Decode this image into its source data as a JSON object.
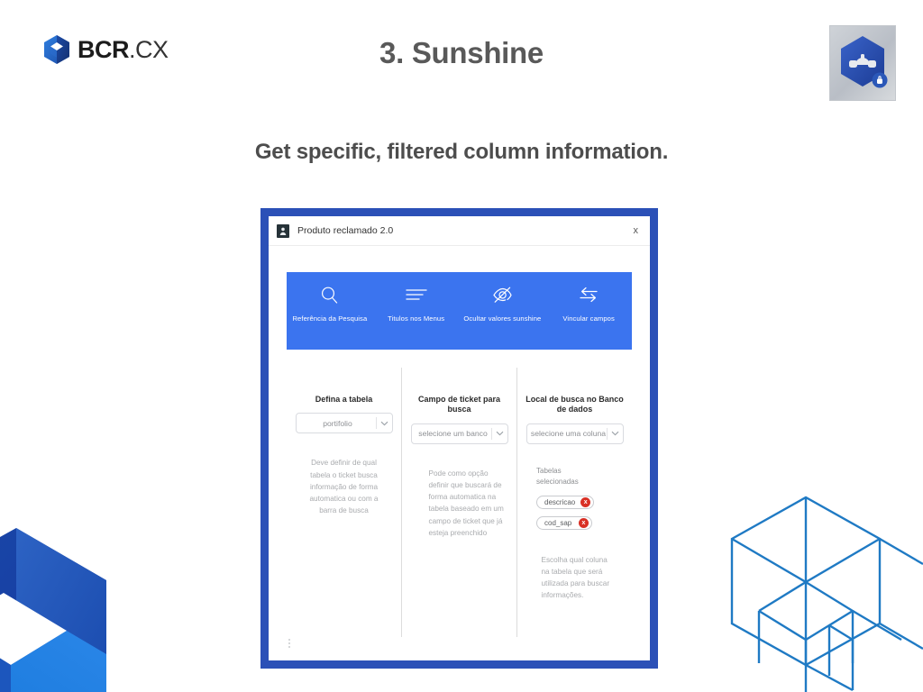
{
  "slide": {
    "title": "3. Sunshine",
    "subtitle": "Get specific, filtered column information.",
    "brand": {
      "name_bold": "BCR",
      "name_thin": ".CX",
      "mark_icon": "bcr-cube-logo-icon"
    },
    "app_badge_icon": "sunshine-hexagon-app-icon"
  },
  "window": {
    "title": "Produto reclamado 2.0",
    "app_icon": "app-tile-icon",
    "close_label": "x",
    "overflow_icon": "kebab-menu-icon",
    "border_color": "#2b50b7"
  },
  "toolbar": {
    "background": "#3b74ef",
    "items": [
      {
        "icon": "search-icon",
        "label": "Referência da Pesquisa"
      },
      {
        "icon": "menu-lines-icon",
        "label": "Titulos nos Menus"
      },
      {
        "icon": "eye-off-icon",
        "label": "Ocultar valores sunshine"
      },
      {
        "icon": "link-arrows-icon",
        "label": "Vincular campos"
      }
    ]
  },
  "form": {
    "columns": [
      {
        "label": "Defina a tabela",
        "select_value": "portifolio",
        "help": "Deve definir de qual tabela o ticket busca informação de forma automatica ou com a barra de busca"
      },
      {
        "label": "Campo de ticket para busca",
        "select_value": "selecione um banco",
        "help": "Pode como opção definir que buscará de forma automatica na tabela baseado em um campo de ticket que já esteja preenchido"
      },
      {
        "label": "Local de busca no Banco de dados",
        "select_value": "selecione uma coluna",
        "tags_title": "Tabelas selecionadas",
        "tags": [
          {
            "text": "descricao",
            "remove_label": "x"
          },
          {
            "text": "cod_sap",
            "remove_label": "x"
          }
        ],
        "help": "Escolha qual coluna na tabela que será utilizada para buscar informações."
      }
    ],
    "dropdown_arrow_icon": "chevron-down-icon",
    "tag_remove_color": "#d93025"
  },
  "decor": {
    "bottom_left_icon": "bcr-cube-graphic",
    "bottom_right_icon": "isometric-cube-outline-graphic",
    "accent_blue": "#1d4ea8",
    "outline_blue": "#1f7ac4"
  }
}
